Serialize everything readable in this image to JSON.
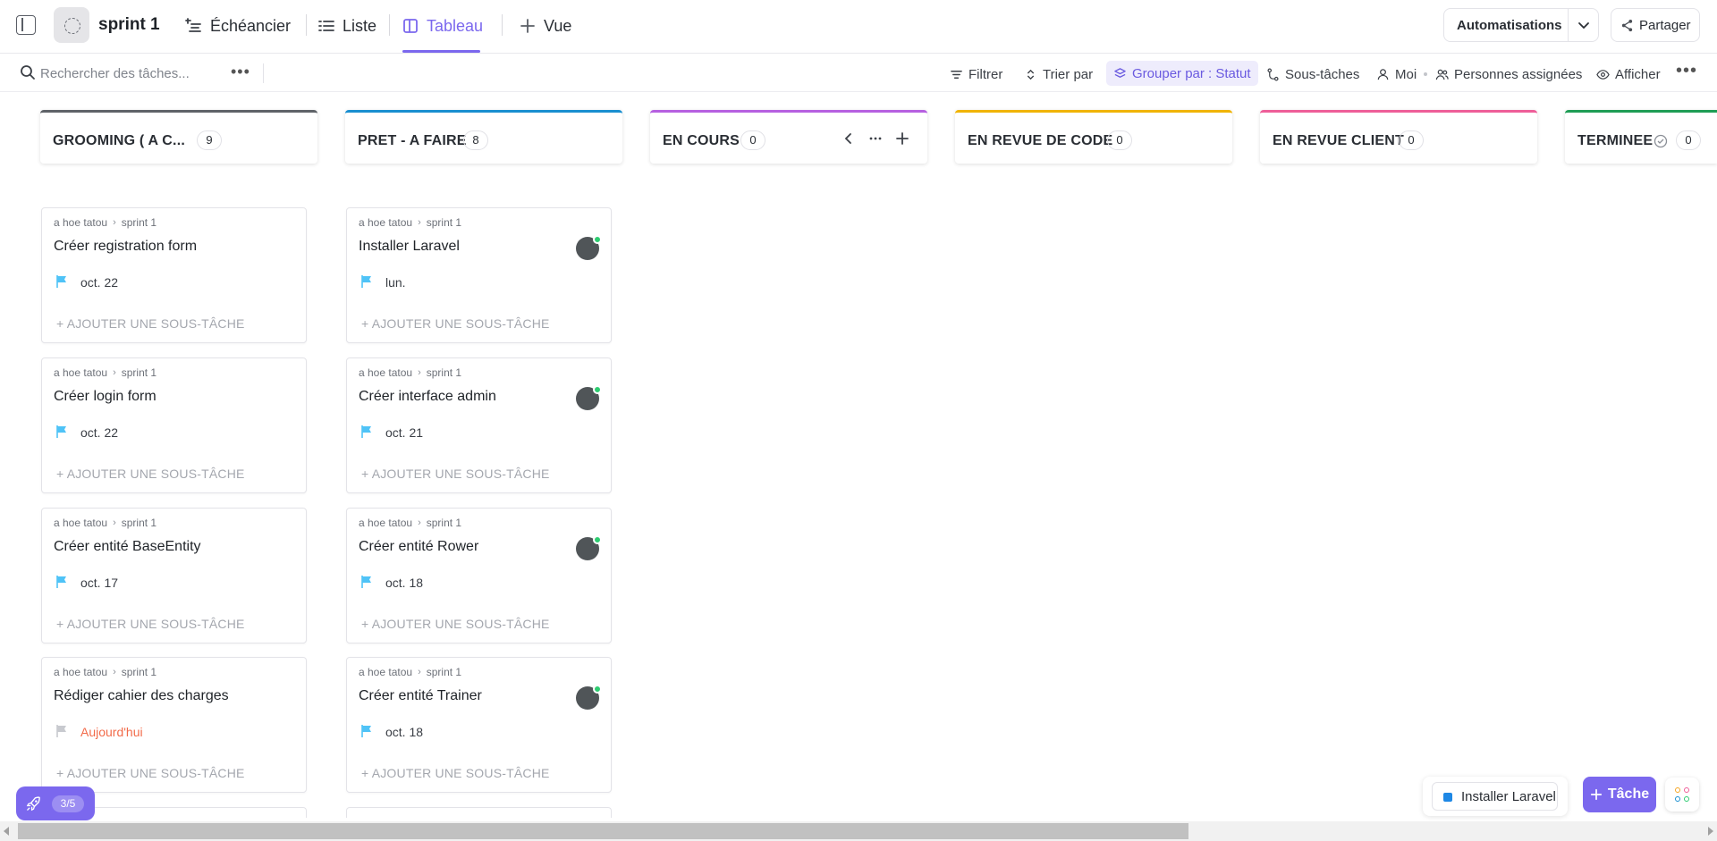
{
  "header": {
    "list_title": "sprint 1",
    "views": [
      {
        "label": "Échéancier",
        "icon": "gantt-icon"
      },
      {
        "label": "Liste",
        "icon": "list-icon"
      },
      {
        "label": "Tableau",
        "icon": "board-icon",
        "active": true
      }
    ],
    "add_view_label": "Vue",
    "automations_label": "Automatisations",
    "share_label": "Partager"
  },
  "toolbar": {
    "search_placeholder": "Rechercher des tâches...",
    "filter_label": "Filtrer",
    "sort_label": "Trier par",
    "group_label": "Grouper par : Statut",
    "subtasks_label": "Sous-tâches",
    "me_label": "Moi",
    "assignees_label": "Personnes assignées",
    "show_label": "Afficher"
  },
  "columns": [
    {
      "title": "GROOMING ( A C...",
      "count": "9",
      "color": "#5f6368"
    },
    {
      "title": "PRET - A FAIRE",
      "count": "8",
      "color": "#1a8fd0"
    },
    {
      "title": "EN COURS",
      "count": "0",
      "color": "#b660e0"
    },
    {
      "title": "EN REVUE DE CODE",
      "count": "0",
      "color": "#f0b400"
    },
    {
      "title": "EN REVUE CLIENT",
      "count": "0",
      "color": "#ee5e99"
    },
    {
      "title": "TERMINEE",
      "count": "0",
      "color": "#1f9d55"
    }
  ],
  "cards": {
    "space": "a hoe tatou",
    "list": "sprint 1",
    "add_subtask_label": "+ AJOUTER UNE SOUS-TÂCHE",
    "grooming": [
      {
        "name": "Créer registration form",
        "date": "oct. 22",
        "flag_color": "#4fc3f7"
      },
      {
        "name": "Créer login form",
        "date": "oct. 22",
        "flag_color": "#4fc3f7"
      },
      {
        "name": "Créer entité BaseEntity",
        "date": "oct. 17",
        "flag_color": "#4fc3f7"
      },
      {
        "name": "Rédiger cahier des charges",
        "date": "Aujourd'hui",
        "flag_color": "#c8cacf",
        "overdue": true
      }
    ],
    "pret": [
      {
        "name": "Installer Laravel",
        "date": "lun.",
        "flag_color": "#4fc3f7"
      },
      {
        "name": "Créer interface admin",
        "date": "oct. 21",
        "flag_color": "#4fc3f7"
      },
      {
        "name": "Créer entité Rower",
        "date": "oct. 18",
        "flag_color": "#4fc3f7"
      },
      {
        "name": "Créer entité Trainer",
        "date": "oct. 18",
        "flag_color": "#4fc3f7"
      }
    ]
  },
  "floating": {
    "onboarding_progress": "3/5",
    "tray_item_label": "Installer Laravel",
    "new_task_label": "Tâche"
  },
  "colors": {
    "accent": "#7b68ee",
    "online": "#2ecc71",
    "overdue": "#f26b4a"
  }
}
